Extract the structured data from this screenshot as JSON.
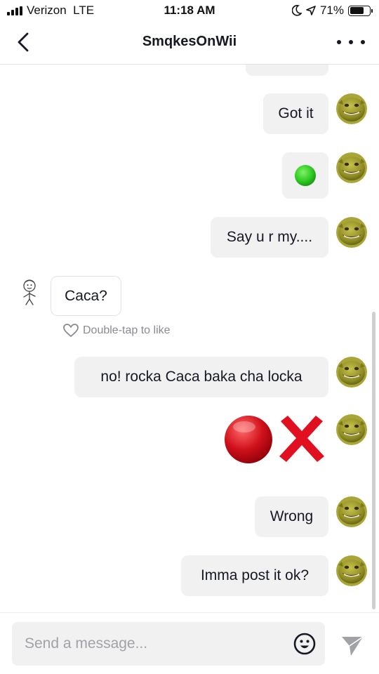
{
  "status_bar": {
    "carrier": "Verizon",
    "network": "LTE",
    "time": "11:18 AM",
    "battery_text": "71%",
    "battery_level": 0.71,
    "icons": [
      "signal-icon",
      "moon-icon",
      "location-arrow-icon",
      "battery-icon"
    ]
  },
  "header": {
    "title": "SmqkesOnWii",
    "back_icon": "chevron-left-icon",
    "more_icon": "more-dots-icon"
  },
  "messages": [
    {
      "side": "outgoing",
      "type": "text",
      "text": ""
    },
    {
      "side": "outgoing",
      "type": "text",
      "text": "Got it"
    },
    {
      "side": "outgoing",
      "type": "emoji",
      "emoji": "green-circle-emoji"
    },
    {
      "side": "outgoing",
      "type": "text",
      "text": "Say u r my...."
    },
    {
      "side": "incoming",
      "type": "text",
      "text": "Caca?"
    },
    {
      "side": "outgoing",
      "type": "text",
      "text": "no! rocka Caca baka cha locka"
    },
    {
      "side": "outgoing",
      "type": "emoji",
      "emoji": "red-circle-cross-mark-emoji"
    },
    {
      "side": "outgoing",
      "type": "text",
      "text": "Wrong"
    },
    {
      "side": "outgoing",
      "type": "text",
      "text": "Imma post it ok?"
    }
  ],
  "like_hint": {
    "text": "Double-tap to like",
    "icon": "heart-outline-icon"
  },
  "composer": {
    "placeholder": "Send a message...",
    "emoji_icon": "smiley-icon",
    "send_icon": "send-icon"
  },
  "colors": {
    "bubble_outgoing": "#f1f1f2",
    "bubble_incoming": "#ffffff",
    "text": "#161823",
    "muted": "#8a8b91",
    "green_emoji": "#2ecc20",
    "red_emoji": "#d0111b",
    "cross_emoji": "#e01020"
  }
}
